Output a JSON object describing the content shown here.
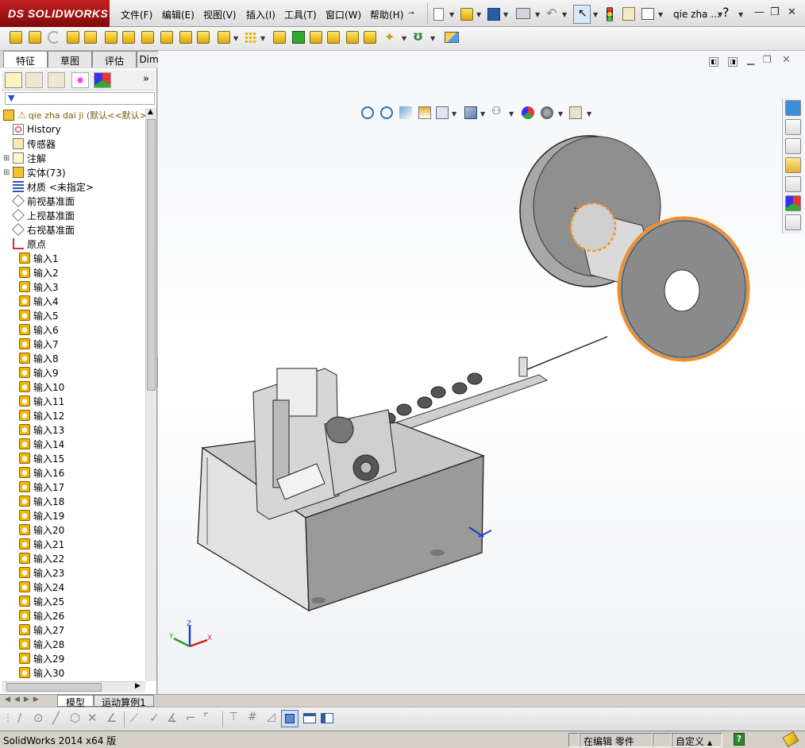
{
  "app": {
    "brand": "SOLIDWORKS",
    "brand_prefix": "DS"
  },
  "menu": [
    "文件(F)",
    "编辑(E)",
    "视图(V)",
    "插入(I)",
    "工具(T)",
    "窗口(W)",
    "帮助(H)"
  ],
  "window": {
    "doc_title": "qie zha ...",
    "help_glyph": "?",
    "min": "—",
    "restore": "❐",
    "close": "✕"
  },
  "tabs": [
    "特征",
    "草图",
    "评估",
    "DimXpert"
  ],
  "tree": {
    "root": "qie zha dai ji  (默认<<默认>",
    "items": [
      {
        "label": "History",
        "icon": "history-icon"
      },
      {
        "label": "传感器",
        "icon": "sensor-icon"
      },
      {
        "label": "注解",
        "icon": "annotation-icon",
        "expander": "+"
      },
      {
        "label": "实体(73)",
        "icon": "solid-body-icon",
        "expander": "+"
      },
      {
        "label": "材质 <未指定>",
        "icon": "material-icon"
      },
      {
        "label": "前视基准面",
        "icon": "plane-icon"
      },
      {
        "label": "上视基准面",
        "icon": "plane-icon"
      },
      {
        "label": "右视基准面",
        "icon": "plane-icon"
      },
      {
        "label": "原点",
        "icon": "origin-icon"
      }
    ],
    "inputs": [
      "输入1",
      "输入2",
      "输入3",
      "输入4",
      "输入5",
      "输入6",
      "输入7",
      "输入8",
      "输入9",
      "输入10",
      "输入11",
      "输入12",
      "输入13",
      "输入14",
      "输入15",
      "输入16",
      "输入17",
      "输入18",
      "输入19",
      "输入20",
      "输入21",
      "输入22",
      "输入23",
      "输入24",
      "输入25",
      "输入26",
      "输入27",
      "输入28",
      "输入29",
      "输入30"
    ]
  },
  "bottom_tabs": [
    "模型",
    "运动算例1"
  ],
  "triad": {
    "x": "X",
    "y": "Y",
    "z": "Z"
  },
  "status": {
    "app_version": "SolidWorks 2014 x64 版",
    "mode": "在编辑 零件",
    "custom": "自定义",
    "help": "?"
  },
  "colors": {
    "accent_red": "#b01818",
    "highlight_orange": "#ff8c1a",
    "part_gray": "#9a9a9a"
  }
}
